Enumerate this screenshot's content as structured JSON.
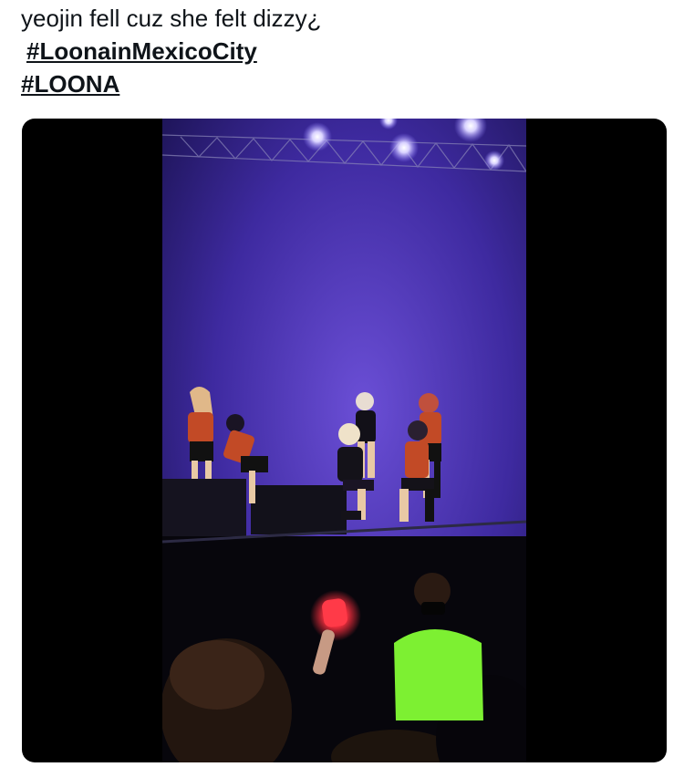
{
  "tweet": {
    "text_line": "yeojin fell cuz she felt dizzy¿",
    "hashtags": [
      "#LoonainMexicoCity",
      "#LOONA"
    ]
  },
  "media": {
    "type": "video-frame",
    "description_icon": "concert-stage-video",
    "colors": {
      "backdrop": "#000000",
      "stage_light": "#5a3fc4",
      "lightstick": "#ff3040",
      "staff_shirt": "#7df032"
    }
  }
}
